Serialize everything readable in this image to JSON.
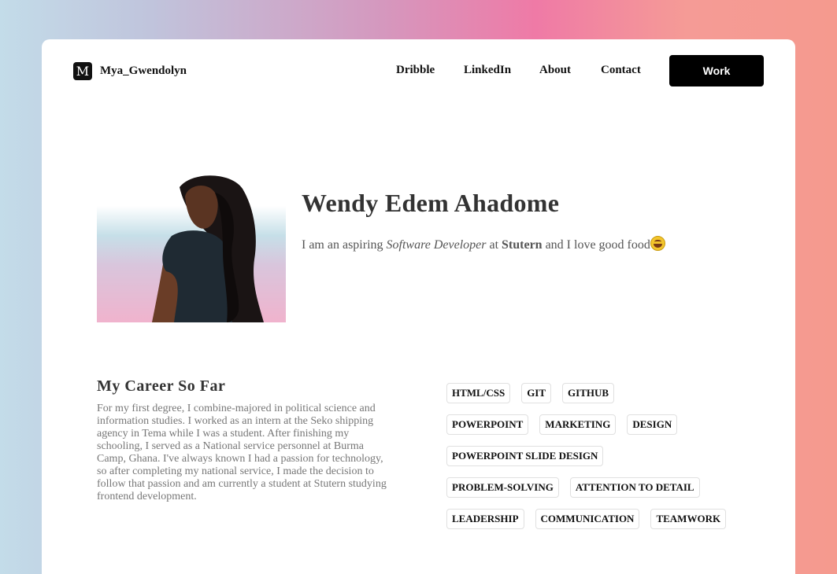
{
  "brand": {
    "logo_letter": "M",
    "name": "Mya_Gwendolyn"
  },
  "nav": {
    "links": [
      "Dribble",
      "LinkedIn",
      "About",
      "Contact"
    ],
    "work_label": "Work"
  },
  "hero": {
    "name": "Wendy Edem Ahadome",
    "intro_prefix": "I am an aspiring ",
    "intro_role": "Software Developer",
    "intro_mid": " at ",
    "intro_company": "Stutern",
    "intro_suffix": " and I love good food",
    "emoji_icon": "laughing-face-icon"
  },
  "career": {
    "title": "My Career So Far",
    "text": "For my first degree, I combine-majored in political science and information studies. I worked as an intern at the Seko shipping agency in Tema while I was a student. After finishing my schooling, I served as a National service personnel at Burma Camp, Ghana. I've always known I had a passion for technology, so after completing my national service, I made the decision to follow that passion and am currently a student at Stutern studying frontend development."
  },
  "skills": [
    [
      "HTML/CSS",
      "GIT",
      "GITHUB"
    ],
    [
      "POWERPOINT",
      "MARKETING",
      "DESIGN"
    ],
    [
      "POWERPOINT SLIDE DESIGN"
    ],
    [
      "PROBLEM-SOLVING",
      "ATTENTION TO DETAIL"
    ],
    [
      "LEADERSHIP",
      "COMMUNICATION",
      "TEAMWORK"
    ]
  ],
  "colors": {
    "button_bg": "#000000",
    "card_bg": "#ffffff",
    "text_dark": "#333333",
    "text_muted": "#777777"
  }
}
